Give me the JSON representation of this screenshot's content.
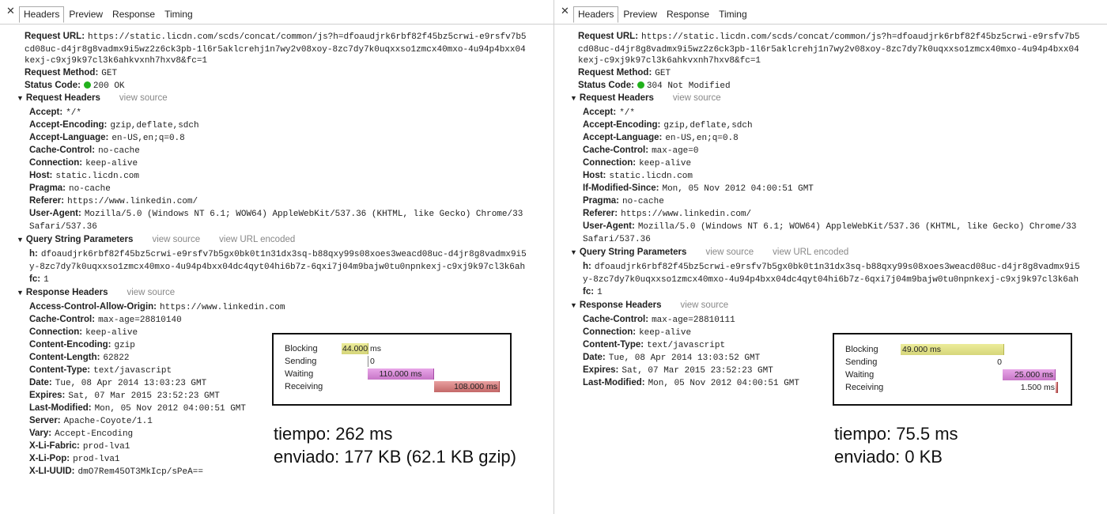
{
  "tabs": [
    "Headers",
    "Preview",
    "Response",
    "Timing"
  ],
  "left": {
    "general": [
      {
        "k": "Request URL:",
        "v": "https://static.licdn.com/scds/concat/common/js?h=dfoaudjrk6rbf82f45bz5crwi-e9rsfv7b5"
      },
      {
        "k": "",
        "v": "cd08uc-d4jr8g8vadmx9i5wz2z6ck3pb-1l6r5akl​crehj1n7wy2v08xoy-8zc7dy7k0uqxxso1zmcx40mxo-4u94p4bxx04"
      },
      {
        "k": "",
        "v": "kexj-c9xj9k97cl3k6ahkvxnh7hxv8&fc=1"
      },
      {
        "k": "Request Method:",
        "v": "GET"
      },
      {
        "k": "Status Code:",
        "v": "200 OK"
      }
    ],
    "request_headers_title": "Request Headers",
    "view_source": "view source",
    "view_url_encoded": "view URL encoded",
    "request_headers": [
      {
        "k": "Accept:",
        "v": "*/*"
      },
      {
        "k": "Accept-Encoding:",
        "v": "gzip,deflate,sdch"
      },
      {
        "k": "Accept-Language:",
        "v": "en-US,en;q=0.8"
      },
      {
        "k": "Cache-Control:",
        "v": "no-cache"
      },
      {
        "k": "Connection:",
        "v": "keep-alive"
      },
      {
        "k": "Host:",
        "v": "static.licdn.com"
      },
      {
        "k": "Pragma:",
        "v": "no-cache"
      },
      {
        "k": "Referer:",
        "v": "https://www.linkedin.com/"
      },
      {
        "k": "User-Agent:",
        "v": "Mozilla/5.0 (Windows NT 6.1; WOW64) AppleWebKit/537.36 (KHTML, like Gecko) Chrome/33"
      },
      {
        "k": "",
        "v": "Safari/537.36"
      }
    ],
    "query_title": "Query String Parameters",
    "query": [
      {
        "k": "h:",
        "v": "dfoaudjrk6rbf82f45bz5crwi-e9rsfv7b5gx0bk0t1n31dx3sq-b88qxy99s08xoes3weacd08uc-d4jr8g8vadmx9i5"
      },
      {
        "k": "",
        "v": "y-8zc7dy7k0uqxxso1zmcx40mxo-4u94p4bxx04dc4qyt04hi6b7z-6qxi7j04m9bajw0tu0npnkexj-c9xj9k97cl3k6ah"
      },
      {
        "k": "fc:",
        "v": "1"
      }
    ],
    "response_headers_title": "Response Headers",
    "response_headers": [
      {
        "k": "Access-Control-Allow-Origin:",
        "v": "https://www.linkedin.com"
      },
      {
        "k": "Cache-Control:",
        "v": "max-age=28810140"
      },
      {
        "k": "Connection:",
        "v": "keep-alive"
      },
      {
        "k": "Content-Encoding:",
        "v": "gzip"
      },
      {
        "k": "Content-Length:",
        "v": "62822"
      },
      {
        "k": "Content-Type:",
        "v": "text/javascript"
      },
      {
        "k": "Date:",
        "v": "Tue, 08 Apr 2014 13:03:23 GMT"
      },
      {
        "k": "Expires:",
        "v": "Sat, 07 Mar 2015 23:52:23 GMT"
      },
      {
        "k": "Last-Modified:",
        "v": "Mon, 05 Nov 2012 04:00:51 GMT"
      },
      {
        "k": "Server:",
        "v": "Apache-Coyote/1.1"
      },
      {
        "k": "Vary:",
        "v": "Accept-Encoding"
      },
      {
        "k": "X-Li-Fabric:",
        "v": "prod-lva1"
      },
      {
        "k": "X-Li-Pop:",
        "v": "prod-lva1"
      },
      {
        "k": "X-LI-UUID:",
        "v": "dmO7Rem45OT3MkIcp/sPeA=="
      }
    ],
    "timing": {
      "labels": [
        "Blocking",
        "Sending",
        "Waiting",
        "Receiving"
      ],
      "blocking": "44.000 ms",
      "sending": "0",
      "waiting": "110.000 ms",
      "receiving": "108.000 ms",
      "values_ms": {
        "blocking": 44,
        "sending": 0,
        "waiting": 110,
        "receiving": 108
      }
    },
    "summary_time": "tiempo: 262 ms",
    "summary_sent": "enviado: 177 KB (62.1 KB gzip)"
  },
  "right": {
    "general": [
      {
        "k": "Request URL:",
        "v": "https://static.licdn.com/scds/concat/common/js?h=dfoaudjrk6rbf82f45bz5crwi-e9rsfv7b5"
      },
      {
        "k": "",
        "v": "cd08uc-d4jr8g8vadmx9i5wz2z6ck3pb-1l6r5akl​crehj1n7wy2v08xoy-8zc7dy7k0uqxxso1zmcx40mxo-4u94p4bxx04"
      },
      {
        "k": "",
        "v": "kexj-c9xj9k97cl3k6ahkvxnh7hxv8&fc=1"
      },
      {
        "k": "Request Method:",
        "v": "GET"
      },
      {
        "k": "Status Code:",
        "v": "304 Not Modified"
      }
    ],
    "request_headers_title": "Request Headers",
    "view_source": "view source",
    "view_url_encoded": "view URL encoded",
    "request_headers": [
      {
        "k": "Accept:",
        "v": "*/*"
      },
      {
        "k": "Accept-Encoding:",
        "v": "gzip,deflate,sdch"
      },
      {
        "k": "Accept-Language:",
        "v": "en-US,en;q=0.8"
      },
      {
        "k": "Cache-Control:",
        "v": "max-age=0"
      },
      {
        "k": "Connection:",
        "v": "keep-alive"
      },
      {
        "k": "Host:",
        "v": "static.licdn.com"
      },
      {
        "k": "If-Modified-Since:",
        "v": "Mon, 05 Nov 2012 04:00:51 GMT"
      },
      {
        "k": "Pragma:",
        "v": "no-cache"
      },
      {
        "k": "Referer:",
        "v": "https://www.linkedin.com/"
      },
      {
        "k": "User-Agent:",
        "v": "Mozilla/5.0 (Windows NT 6.1; WOW64) AppleWebKit/537.36 (KHTML, like Gecko) Chrome/33"
      },
      {
        "k": "",
        "v": "Safari/537.36"
      }
    ],
    "query_title": "Query String Parameters",
    "query": [
      {
        "k": "h:",
        "v": "dfoaudjrk6rbf82f45bz5crwi-e9rsfv7b5gx0bk0t1n31dx3sq-b88qxy99s08xoes3weacd08uc-d4jr8g8vadmx9i5"
      },
      {
        "k": "",
        "v": "y-8zc7dy7k0uqxxso1zmcx40mxo-4u94p4bxx04dc4qyt04hi6b7z-6qxi7j04m9bajw0tu0npnkexj-c9xj9k97cl3k6ah"
      },
      {
        "k": "fc:",
        "v": "1"
      }
    ],
    "response_headers_title": "Response Headers",
    "response_headers": [
      {
        "k": "Cache-Control:",
        "v": "max-age=28810111"
      },
      {
        "k": "Connection:",
        "v": "keep-alive"
      },
      {
        "k": "Content-Type:",
        "v": "text/javascript"
      },
      {
        "k": "Date:",
        "v": "Tue, 08 Apr 2014 13:03:52 GMT"
      },
      {
        "k": "Expires:",
        "v": "Sat, 07 Mar 2015 23:52:23 GMT"
      },
      {
        "k": "Last-Modified:",
        "v": "Mon, 05 Nov 2012 04:00:51 GMT"
      }
    ],
    "timing": {
      "labels": [
        "Blocking",
        "Sending",
        "Waiting",
        "Receiving"
      ],
      "blocking": "49.000 ms",
      "sending": "0",
      "waiting": "25.000 ms",
      "receiving": "1.500 ms",
      "values_ms": {
        "blocking": 49,
        "sending": 0,
        "waiting": 25,
        "receiving": 1.5
      }
    },
    "summary_time": "tiempo: 75.5 ms",
    "summary_sent": "enviado: 0 KB"
  }
}
